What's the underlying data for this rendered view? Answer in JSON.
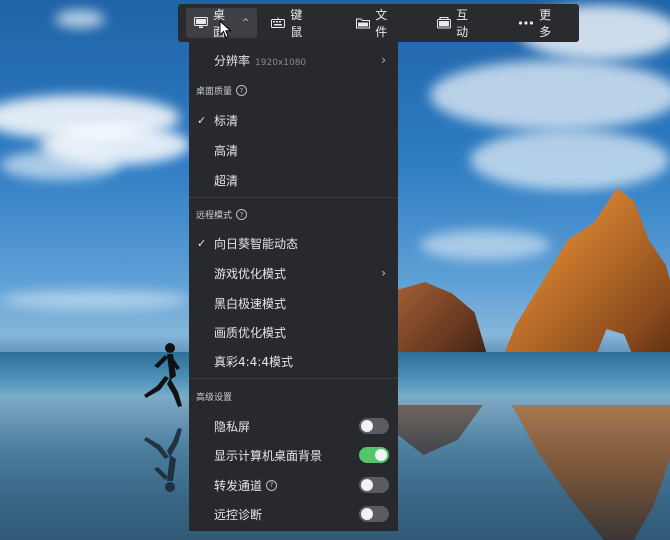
{
  "toolbar": {
    "items": [
      {
        "label": "桌面",
        "icon": "monitor-icon",
        "active": true
      },
      {
        "label": "键鼠",
        "icon": "keyboard-icon"
      },
      {
        "label": "文件",
        "icon": "folder-icon"
      },
      {
        "label": "互动",
        "icon": "interaction-icon"
      },
      {
        "label": "更多",
        "icon": "more-dots-icon"
      }
    ]
  },
  "menu": {
    "resolution": {
      "label": "分辨率",
      "value": "1920x1080"
    },
    "quality": {
      "title": "桌面质量",
      "options": [
        "标清",
        "高清",
        "超清"
      ],
      "selected": "标清"
    },
    "mode": {
      "title": "远程模式",
      "options": [
        "向日葵智能动态",
        "游戏优化模式",
        "黑白极速模式",
        "画质优化模式",
        "真彩4:4:4模式"
      ],
      "selected": "向日葵智能动态"
    },
    "advanced": {
      "title": "高级设置",
      "toggles": [
        {
          "label": "隐私屏",
          "on": false
        },
        {
          "label": "显示计算机桌面背景",
          "on": true
        },
        {
          "label": "转发通道",
          "on": false,
          "help": true
        },
        {
          "label": "远控诊断",
          "on": false
        }
      ]
    }
  },
  "colors": {
    "toggle_on": "#53c66b",
    "menu_bg": "#28292c",
    "toolbar_bg": "#2a2b2e"
  }
}
